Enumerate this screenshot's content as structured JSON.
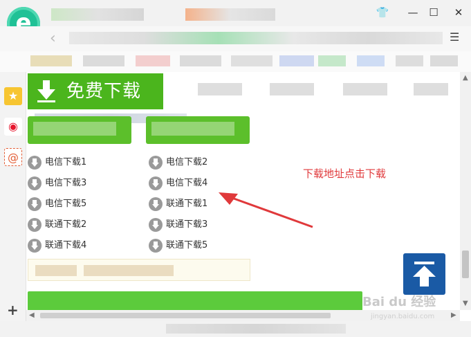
{
  "browser": {
    "icon": "browser-e-logo",
    "logo_letter": "e",
    "window_buttons": [
      {
        "name": "skin-icon",
        "glyph": "👕"
      },
      {
        "name": "minimize-icon",
        "glyph": "—"
      },
      {
        "name": "maximize-icon",
        "glyph": "☐"
      },
      {
        "name": "close-icon",
        "glyph": "✕"
      }
    ],
    "back_glyph": "‹",
    "menu_glyph": "☰"
  },
  "sidebar": {
    "items": [
      {
        "name": "favorites-icon",
        "glyph": "★",
        "color": "#f7c531"
      },
      {
        "name": "weibo-icon",
        "glyph": "◉",
        "color": "#e6162d"
      },
      {
        "name": "mail-icon",
        "glyph": "@",
        "color": "#e25d35"
      }
    ],
    "add_glyph": "+"
  },
  "main": {
    "free_download_label": "免费下载",
    "download_links": [
      "电信下载1",
      "电信下载2",
      "电信下载3",
      "电信下载4",
      "电信下载5",
      "联通下载1",
      "联通下载2",
      "联通下载3",
      "联通下载4",
      "联通下载5"
    ],
    "annotation_text": "下载地址点击下载"
  },
  "watermark": {
    "text": "Bai du 经验",
    "sub": "jingyan.baidu.com"
  },
  "colors": {
    "green": "#4bb51d",
    "annotation_red": "#e0393b",
    "top_button_blue": "#1a5aa5"
  }
}
